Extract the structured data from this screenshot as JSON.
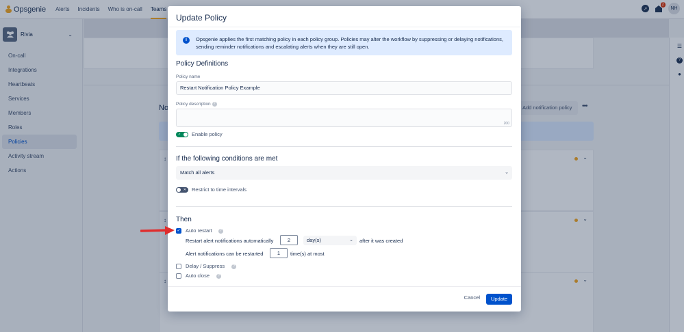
{
  "topnav": {
    "logo": "Opsgenie",
    "items": [
      "Alerts",
      "Incidents",
      "Who is on-call",
      "Teams"
    ],
    "notification_count": "2",
    "user_initials": "NH",
    "colors": {
      "accent": "#f7a823",
      "primary": "#0052cc"
    }
  },
  "sidebar": {
    "team_name": "Rivia",
    "items": [
      "On-call",
      "Integrations",
      "Heartbeats",
      "Services",
      "Members",
      "Roles",
      "Policies",
      "Activity stream",
      "Actions"
    ],
    "active_item": "Policies"
  },
  "background": {
    "heading_fragment": "No",
    "add_button": "Add notification policy"
  },
  "modal": {
    "title": "Update Policy",
    "info_text": "Opsgenie applies the first matching policy in each policy group. Policies may alter the workflow by suppressing or delaying notifications, sending reminder notifications and escalating alerts when they are still open.",
    "definitions_title": "Policy Definitions",
    "name_label": "Policy name",
    "name_value": "Restart Notification Policy Example",
    "description_label": "Policy description",
    "description_counter": "200",
    "enable_label": "Enable policy",
    "enable_on": true,
    "conditions_title": "If the following conditions are met",
    "match_value": "Match all alerts",
    "restrict_label": "Restrict to time intervals",
    "restrict_on": false,
    "then_title": "Then",
    "auto_restart_label": "Auto restart",
    "auto_restart_checked": true,
    "restart_row_label": "Restart alert notifications automatically",
    "restart_value": "2",
    "restart_unit": "day(s)",
    "restart_suffix": "after it was created",
    "restart_count_label": "Alert notifications can be restarted",
    "restart_count_value": "1",
    "restart_count_suffix": "time(s) at most",
    "delay_label": "Delay / Suppress",
    "auto_close_label": "Auto close",
    "cancel_label": "Cancel",
    "update_label": "Update"
  }
}
